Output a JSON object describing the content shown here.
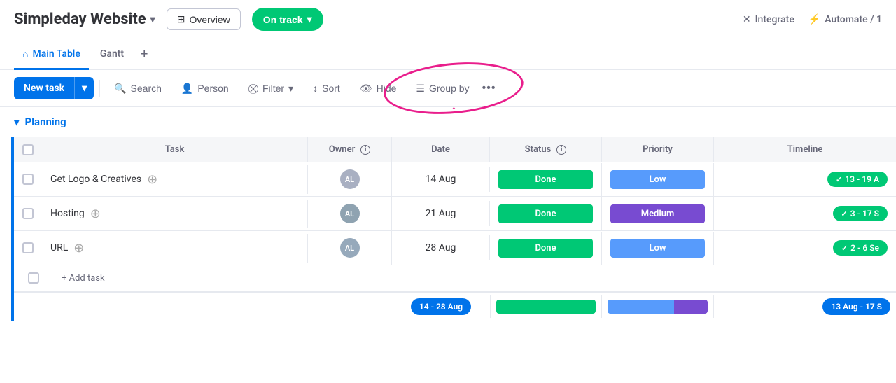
{
  "header": {
    "title": "Simpleday Website",
    "overview_label": "Overview",
    "status_label": "On track",
    "integrate_label": "Integrate",
    "automate_label": "Automate / 1"
  },
  "tabs": [
    {
      "label": "Main Table",
      "active": true
    },
    {
      "label": "Gantt",
      "active": false
    }
  ],
  "toolbar": {
    "new_task_label": "New task",
    "search_label": "Search",
    "person_label": "Person",
    "filter_label": "Filter",
    "sort_label": "Sort",
    "hide_label": "Hide",
    "group_by_label": "Group by"
  },
  "group": {
    "name": "Planning"
  },
  "table": {
    "columns": [
      "Task",
      "Owner",
      "Date",
      "Status",
      "Priority",
      "Timeline"
    ],
    "rows": [
      {
        "task": "Get Logo & Creatives",
        "owner_initials": "AL",
        "date": "14 Aug",
        "status": "Done",
        "priority": "Low",
        "timeline": "13 - 19 A"
      },
      {
        "task": "Hosting",
        "owner_initials": "AL",
        "date": "21 Aug",
        "status": "Done",
        "priority": "Medium",
        "timeline": "3 - 17 S"
      },
      {
        "task": "URL",
        "owner_initials": "AL",
        "date": "28 Aug",
        "status": "Done",
        "priority": "Low",
        "timeline": "2 - 6 Se"
      }
    ],
    "add_task_label": "+ Add task"
  },
  "summary": {
    "date_range": "14 - 28 Aug",
    "timeline_range": "13 Aug - 17 S"
  },
  "colors": {
    "primary": "#0073ea",
    "on_track": "#00c875",
    "done": "#00c875",
    "low": "#579bfc",
    "medium": "#784bd1",
    "highlight_circle": "#e91e8c"
  },
  "icons": {
    "chevron_down": "▾",
    "chevron_right": "›",
    "overview": "⊞",
    "integrate": "✕",
    "automate": "⚡",
    "search": "🔍",
    "person": "👤",
    "filter": "⛒",
    "sort": "↕",
    "hide": "👁",
    "group_by": "☰",
    "more": "•••",
    "add": "⊕",
    "check": "✓"
  }
}
